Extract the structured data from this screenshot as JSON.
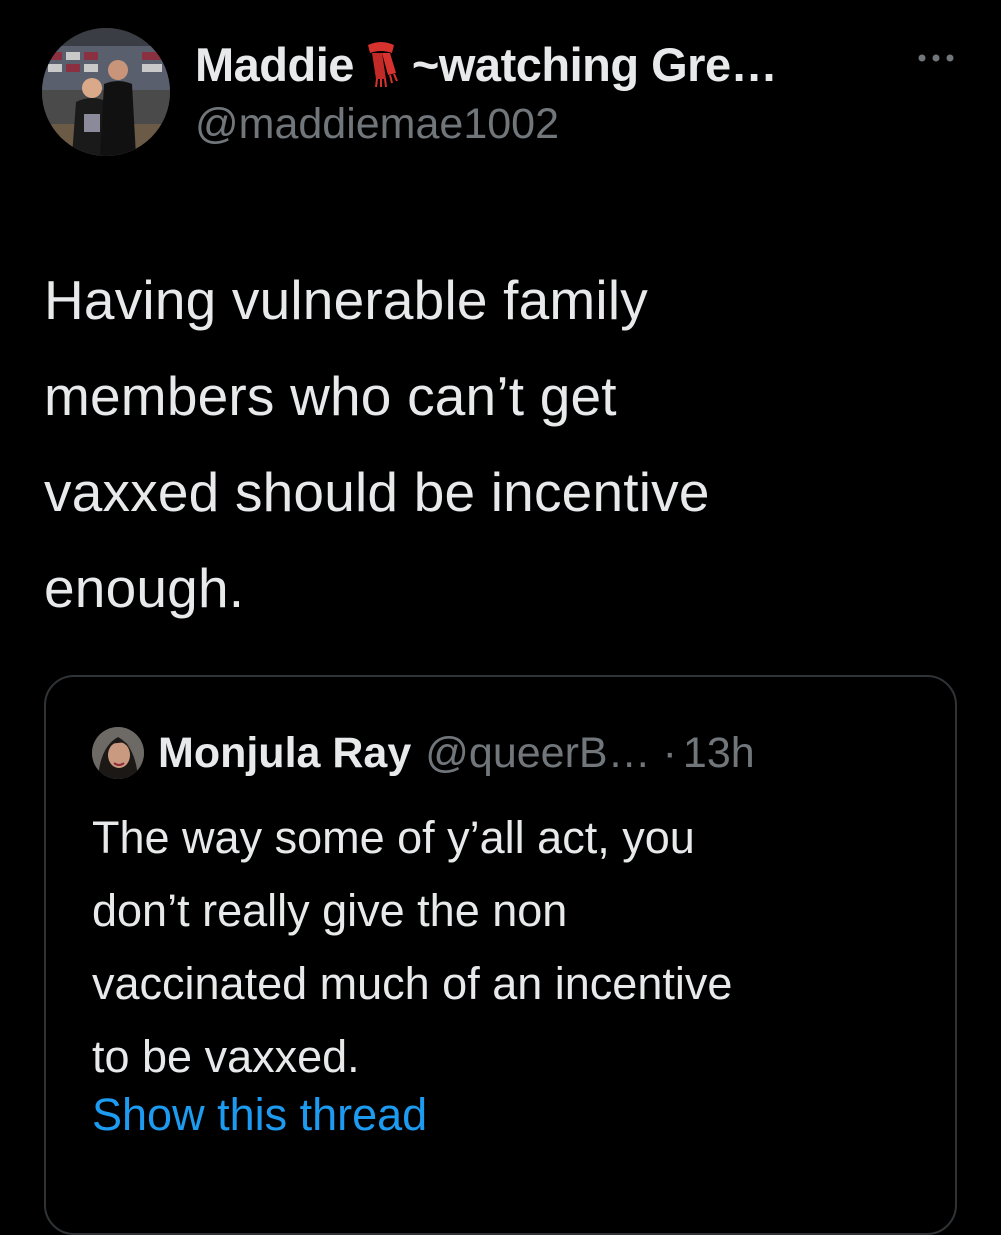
{
  "author": {
    "display_name": "Maddie",
    "display_emoji_icon": "scarf-icon",
    "display_status": "~watching Gre…",
    "handle": "@maddiemae1002",
    "avatar_icon": "profile-photo"
  },
  "tweet": {
    "text": "Having vulnerable family\nmembers who can’t get\nvaxxed should be incentive\nenough."
  },
  "quoted_tweet": {
    "name": "Monjula Ray",
    "handle": "@queerB…",
    "separator": "·",
    "time": "13h",
    "text": "The way some of y’all act, you\ndon’t really give the non\nvaccinated much of an incentive\nto be vaxxed.",
    "show_thread_label": "Show this thread"
  },
  "colors": {
    "background": "#000000",
    "text_primary": "#e7e9ea",
    "text_secondary": "#71767b",
    "link": "#1d9bf0",
    "border": "#2f3336",
    "scarf": "#d8322f"
  }
}
